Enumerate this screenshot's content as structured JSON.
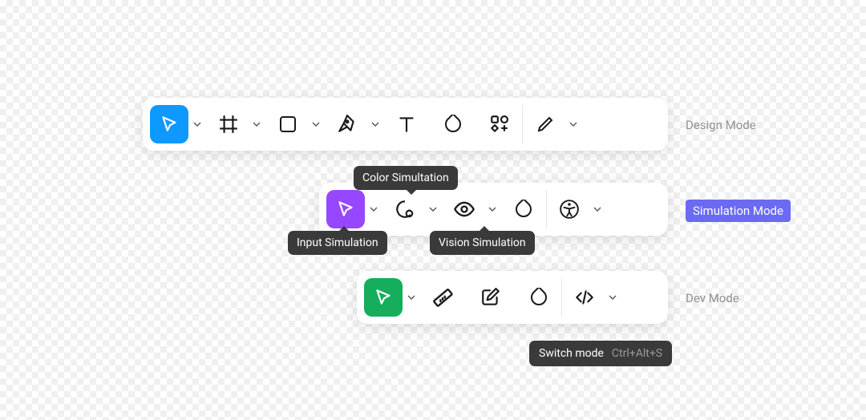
{
  "design_mode": {
    "label": "Design Mode"
  },
  "simulation_mode": {
    "badge": "Simulation Mode",
    "tooltips": {
      "color": "Color Simultation",
      "input": "Input Simulation",
      "vision": "Vision Simulation"
    }
  },
  "dev_mode": {
    "label": "Dev Mode"
  },
  "shortcut": {
    "label": "Switch mode",
    "keys": "Ctrl+Alt+S"
  }
}
